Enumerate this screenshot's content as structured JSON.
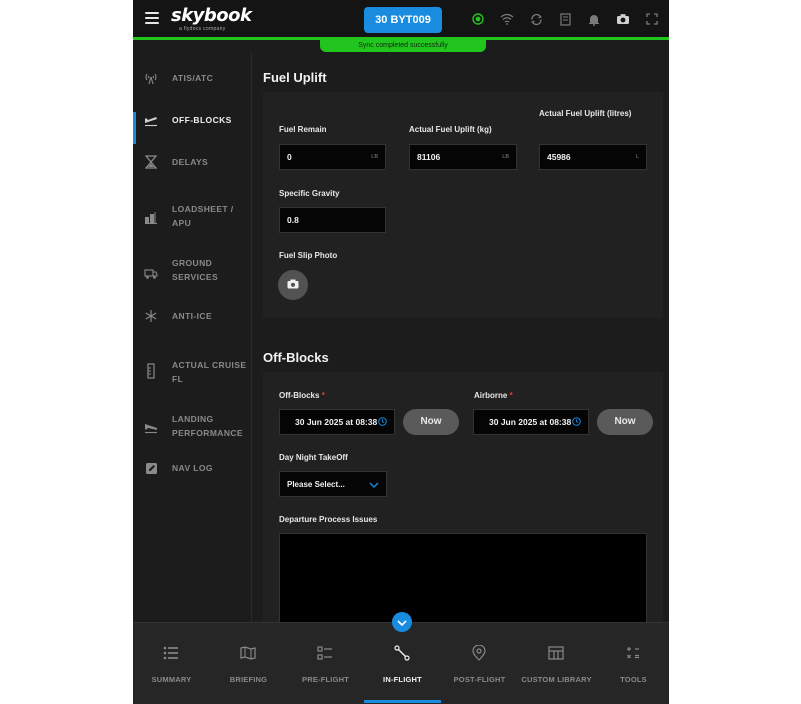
{
  "header": {
    "logo_text": "skybook",
    "logo_subtitle": "a flydocs company",
    "flight_button": "30 BYT009",
    "sync_message": "Sync completed successfully",
    "icons": [
      "status-dot-icon",
      "wifi-icon",
      "sync-icon",
      "document-icon",
      "bell-icon",
      "camera-icon",
      "expand-icon"
    ],
    "colors": {
      "accent": "#1a8ce0",
      "sync_green": "#22c51e"
    }
  },
  "sidebar": {
    "items": [
      {
        "label": "ATIS/ATC",
        "icon": "antenna-icon"
      },
      {
        "label": "OFF-BLOCKS",
        "icon": "takeoff-icon",
        "active": true
      },
      {
        "label": "DELAYS",
        "icon": "hourglass-icon"
      },
      {
        "label": "LOADSHEET / APU",
        "icon": "loadsheet-icon"
      },
      {
        "label": "GROUND SERVICES",
        "icon": "fuel-truck-icon"
      },
      {
        "label": "ANTI-ICE",
        "icon": "snowflake-icon"
      },
      {
        "label": "ACTUAL CRUISE FL",
        "icon": "altimeter-icon"
      },
      {
        "label": "LANDING PERFORMANCE",
        "icon": "landing-icon"
      },
      {
        "label": "NAV LOG",
        "icon": "edit-icon"
      }
    ]
  },
  "fuel_uplift": {
    "title": "Fuel Uplift",
    "fuel_remain": {
      "label": "Fuel Remain",
      "value": "0",
      "unit": "LB"
    },
    "actual_uplift_kg": {
      "label": "Actual Fuel Uplift (kg)",
      "value": "81106",
      "unit": "LB"
    },
    "actual_uplift_litres": {
      "label": "Actual Fuel Uplift (litres)",
      "value": "45986",
      "unit": "L"
    },
    "specific_gravity": {
      "label": "Specific Gravity",
      "value": "0.8"
    },
    "fuel_slip_photo": {
      "label": "Fuel Slip Photo"
    }
  },
  "off_blocks": {
    "title": "Off-Blocks",
    "off_blocks_time": {
      "label": "Off-Blocks",
      "required": "*",
      "value": "30 Jun 2025 at 08:38"
    },
    "airborne_time": {
      "label": "Airborne",
      "required": "*",
      "value": "30 Jun 2025 at 08:38"
    },
    "now_label": "Now",
    "day_night": {
      "label": "Day Night TakeOff",
      "value": "Please Select..."
    },
    "departure_issues": {
      "label": "Departure Process Issues",
      "value": ""
    }
  },
  "bottom_nav": {
    "items": [
      {
        "label": "SUMMARY",
        "icon": "list-icon"
      },
      {
        "label": "BRIEFING",
        "icon": "map-icon"
      },
      {
        "label": "PRE-FLIGHT",
        "icon": "checklist-icon"
      },
      {
        "label": "IN-FLIGHT",
        "icon": "route-icon",
        "active": true
      },
      {
        "label": "POST-FLIGHT",
        "icon": "location-pin-icon"
      },
      {
        "label": "CUSTOM LIBRARY",
        "icon": "library-icon"
      },
      {
        "label": "TOOLS",
        "icon": "calculator-icon"
      }
    ]
  }
}
